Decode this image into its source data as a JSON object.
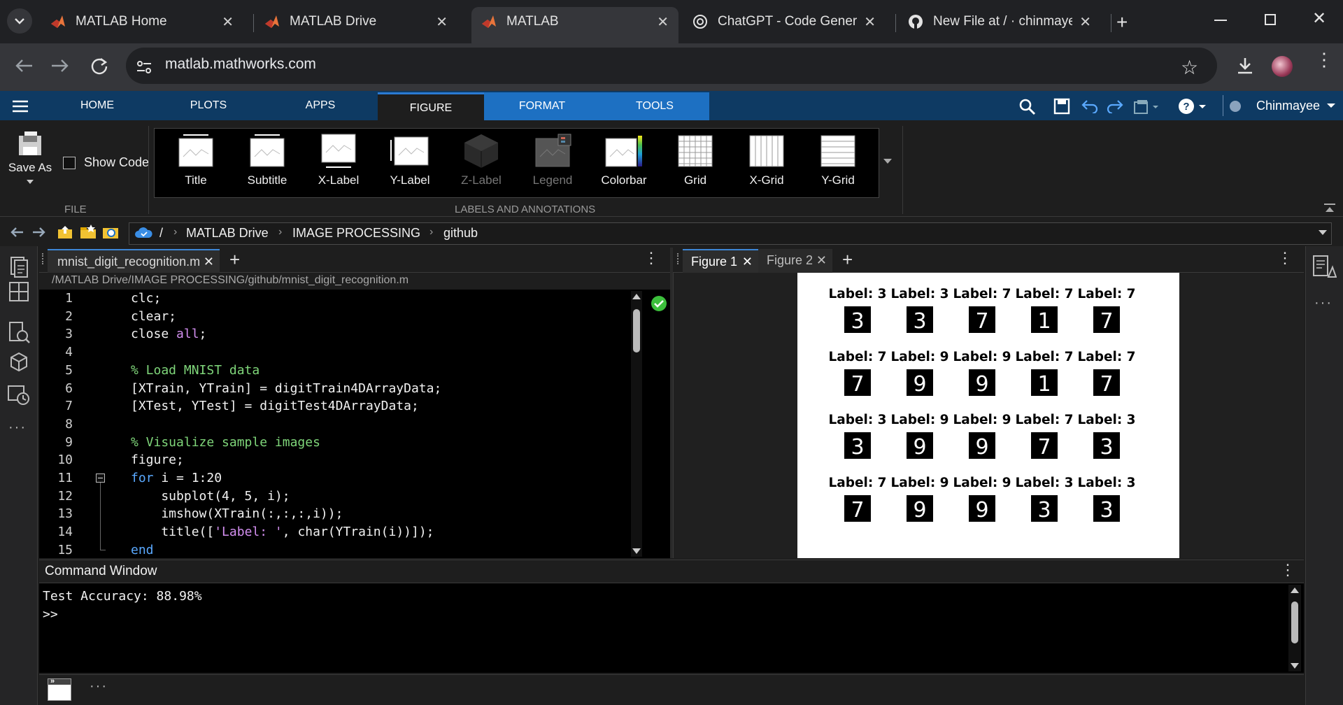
{
  "browser": {
    "tabs": [
      {
        "title": "MATLAB Home"
      },
      {
        "title": "MATLAB Drive"
      },
      {
        "title": "MATLAB"
      },
      {
        "title": "ChatGPT - Code Generato"
      },
      {
        "title": "New File at / · chinmayee"
      }
    ],
    "url": "matlab.mathworks.com"
  },
  "toolstrip": {
    "tabs": [
      "HOME",
      "PLOTS",
      "APPS",
      "FIGURE",
      "FORMAT",
      "TOOLS"
    ],
    "user": "Chinmayee",
    "file_group": {
      "save_as": "Save As",
      "show_code": "Show Code",
      "label": "FILE"
    },
    "labels_group": {
      "label": "LABELS AND ANNOTATIONS",
      "items": [
        "Title",
        "Subtitle",
        "X-Label",
        "Y-Label",
        "Z-Label",
        "Legend",
        "Colorbar",
        "Grid",
        "X-Grid",
        "Y-Grid"
      ]
    }
  },
  "path": {
    "root": "/",
    "crumbs": [
      "MATLAB Drive",
      "IMAGE PROCESSING",
      "github"
    ]
  },
  "editor": {
    "tab": "mnist_digit_recognition.m",
    "file_path": "/MATLAB Drive/IMAGE PROCESSING/github/mnist_digit_recognition.m",
    "line_numbers": [
      "1",
      "2",
      "3",
      "4",
      "5",
      "6",
      "7",
      "8",
      "9",
      "10",
      "11",
      "12",
      "13",
      "14",
      "15"
    ]
  },
  "figure": {
    "tabs": [
      "Figure 1",
      "Figure 2"
    ],
    "labels": [
      "Label: 3",
      "Label: 3",
      "Label: 7",
      "Label: 7",
      "Label: 7",
      "Label: 7",
      "Label: 9",
      "Label: 9",
      "Label: 7",
      "Label: 7",
      "Label: 3",
      "Label: 9",
      "Label: 9",
      "Label: 7",
      "Label: 3",
      "Label: 7",
      "Label: 9",
      "Label: 9",
      "Label: 3",
      "Label: 3"
    ],
    "digits": [
      "3",
      "3",
      "7",
      "1",
      "7",
      "7",
      "9",
      "9",
      "1",
      "7",
      "3",
      "9",
      "9",
      "7",
      "3",
      "7",
      "9",
      "9",
      "3",
      "3"
    ]
  },
  "command_window": {
    "title": "Command Window",
    "output": "Test Accuracy: 88.98%",
    "prompt": ">>"
  }
}
